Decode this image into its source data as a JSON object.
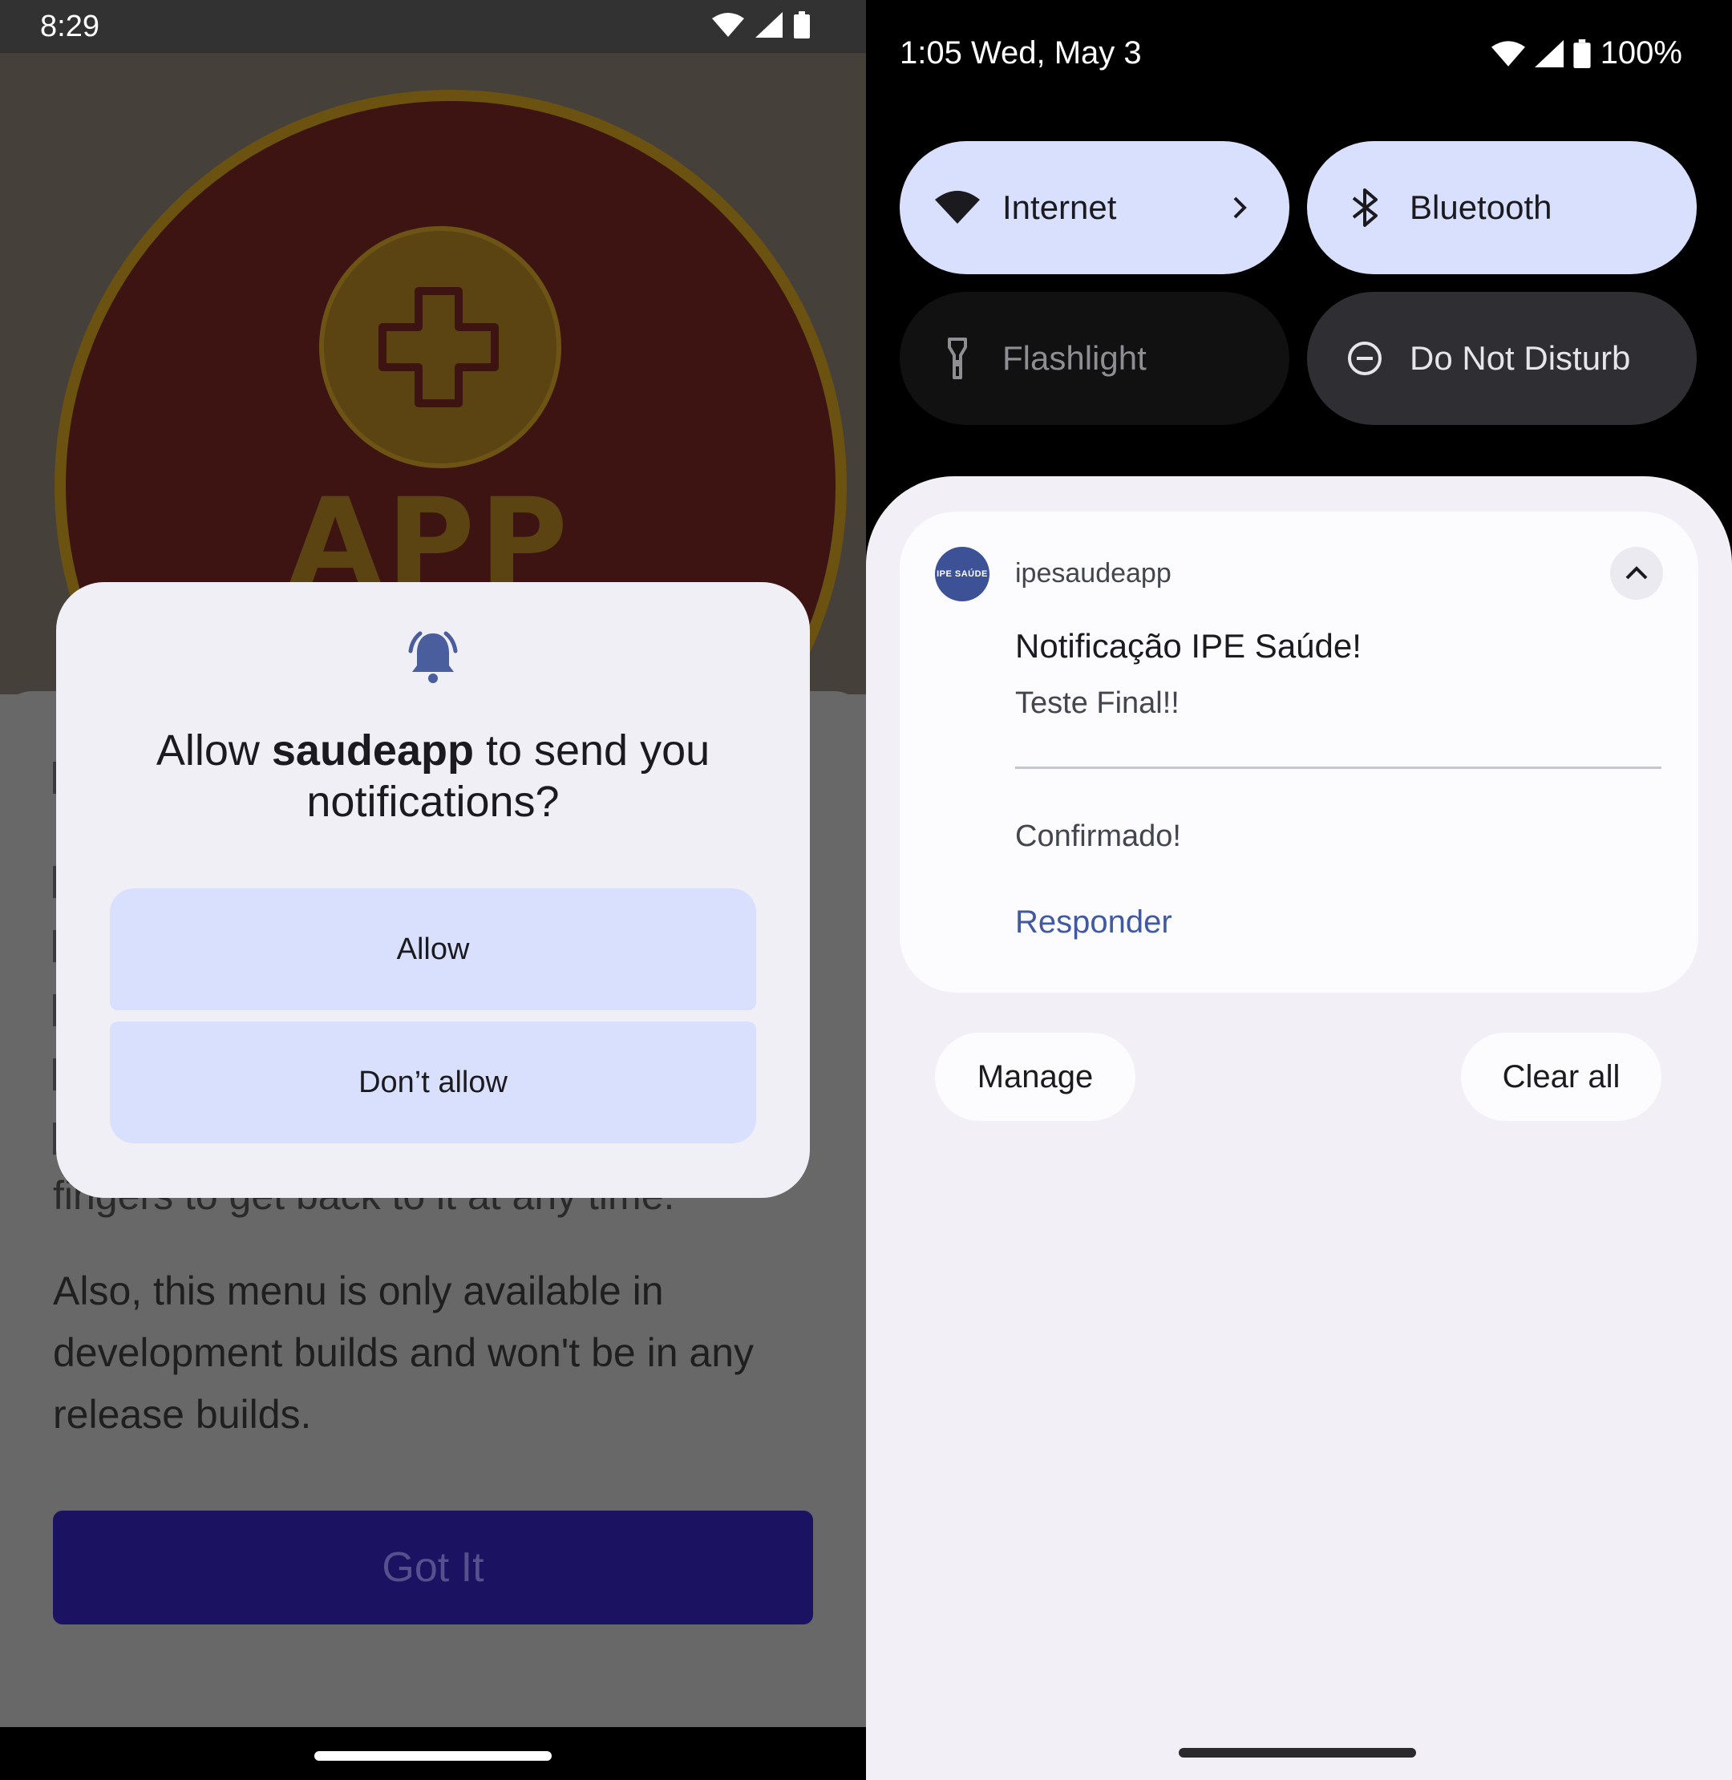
{
  "left": {
    "status": {
      "time": "8:29"
    },
    "splash": {
      "logo_text": "APP"
    },
    "sheet": {
      "fragment": "fingers to get back to it at any time.",
      "paragraph": "Also, this menu is only available in development builds and won't be in any release builds.",
      "got_it_label": "Got It"
    },
    "dialog": {
      "title_prefix": "Allow ",
      "app_name": "saudeapp",
      "title_suffix": " to send you notifications?",
      "allow_label": "Allow",
      "deny_label": "Don’t allow"
    }
  },
  "right": {
    "status": {
      "time": "1:05",
      "date": "Wed, May 3",
      "battery": "100%"
    },
    "tiles": [
      {
        "label": "Internet",
        "state": "on"
      },
      {
        "label": "Bluetooth",
        "state": "on"
      },
      {
        "label": "Flashlight",
        "state": "off"
      },
      {
        "label": "Do Not Disturb",
        "state": "off"
      }
    ],
    "notification": {
      "app_icon_text": "IPE SAÚDE",
      "app_name": "ipesaudeapp",
      "title": "Notificação IPE Saúde!",
      "body": "Teste Final!!",
      "reply": "Confirmado!",
      "action": "Responder"
    },
    "manage_label": "Manage",
    "clear_all_label": "Clear all"
  },
  "colors": {
    "accent_tile": "#d9e0fd",
    "notif_action": "#4159a0",
    "got_it_bg": "#1c1262",
    "bell": "#4a5d9c"
  }
}
